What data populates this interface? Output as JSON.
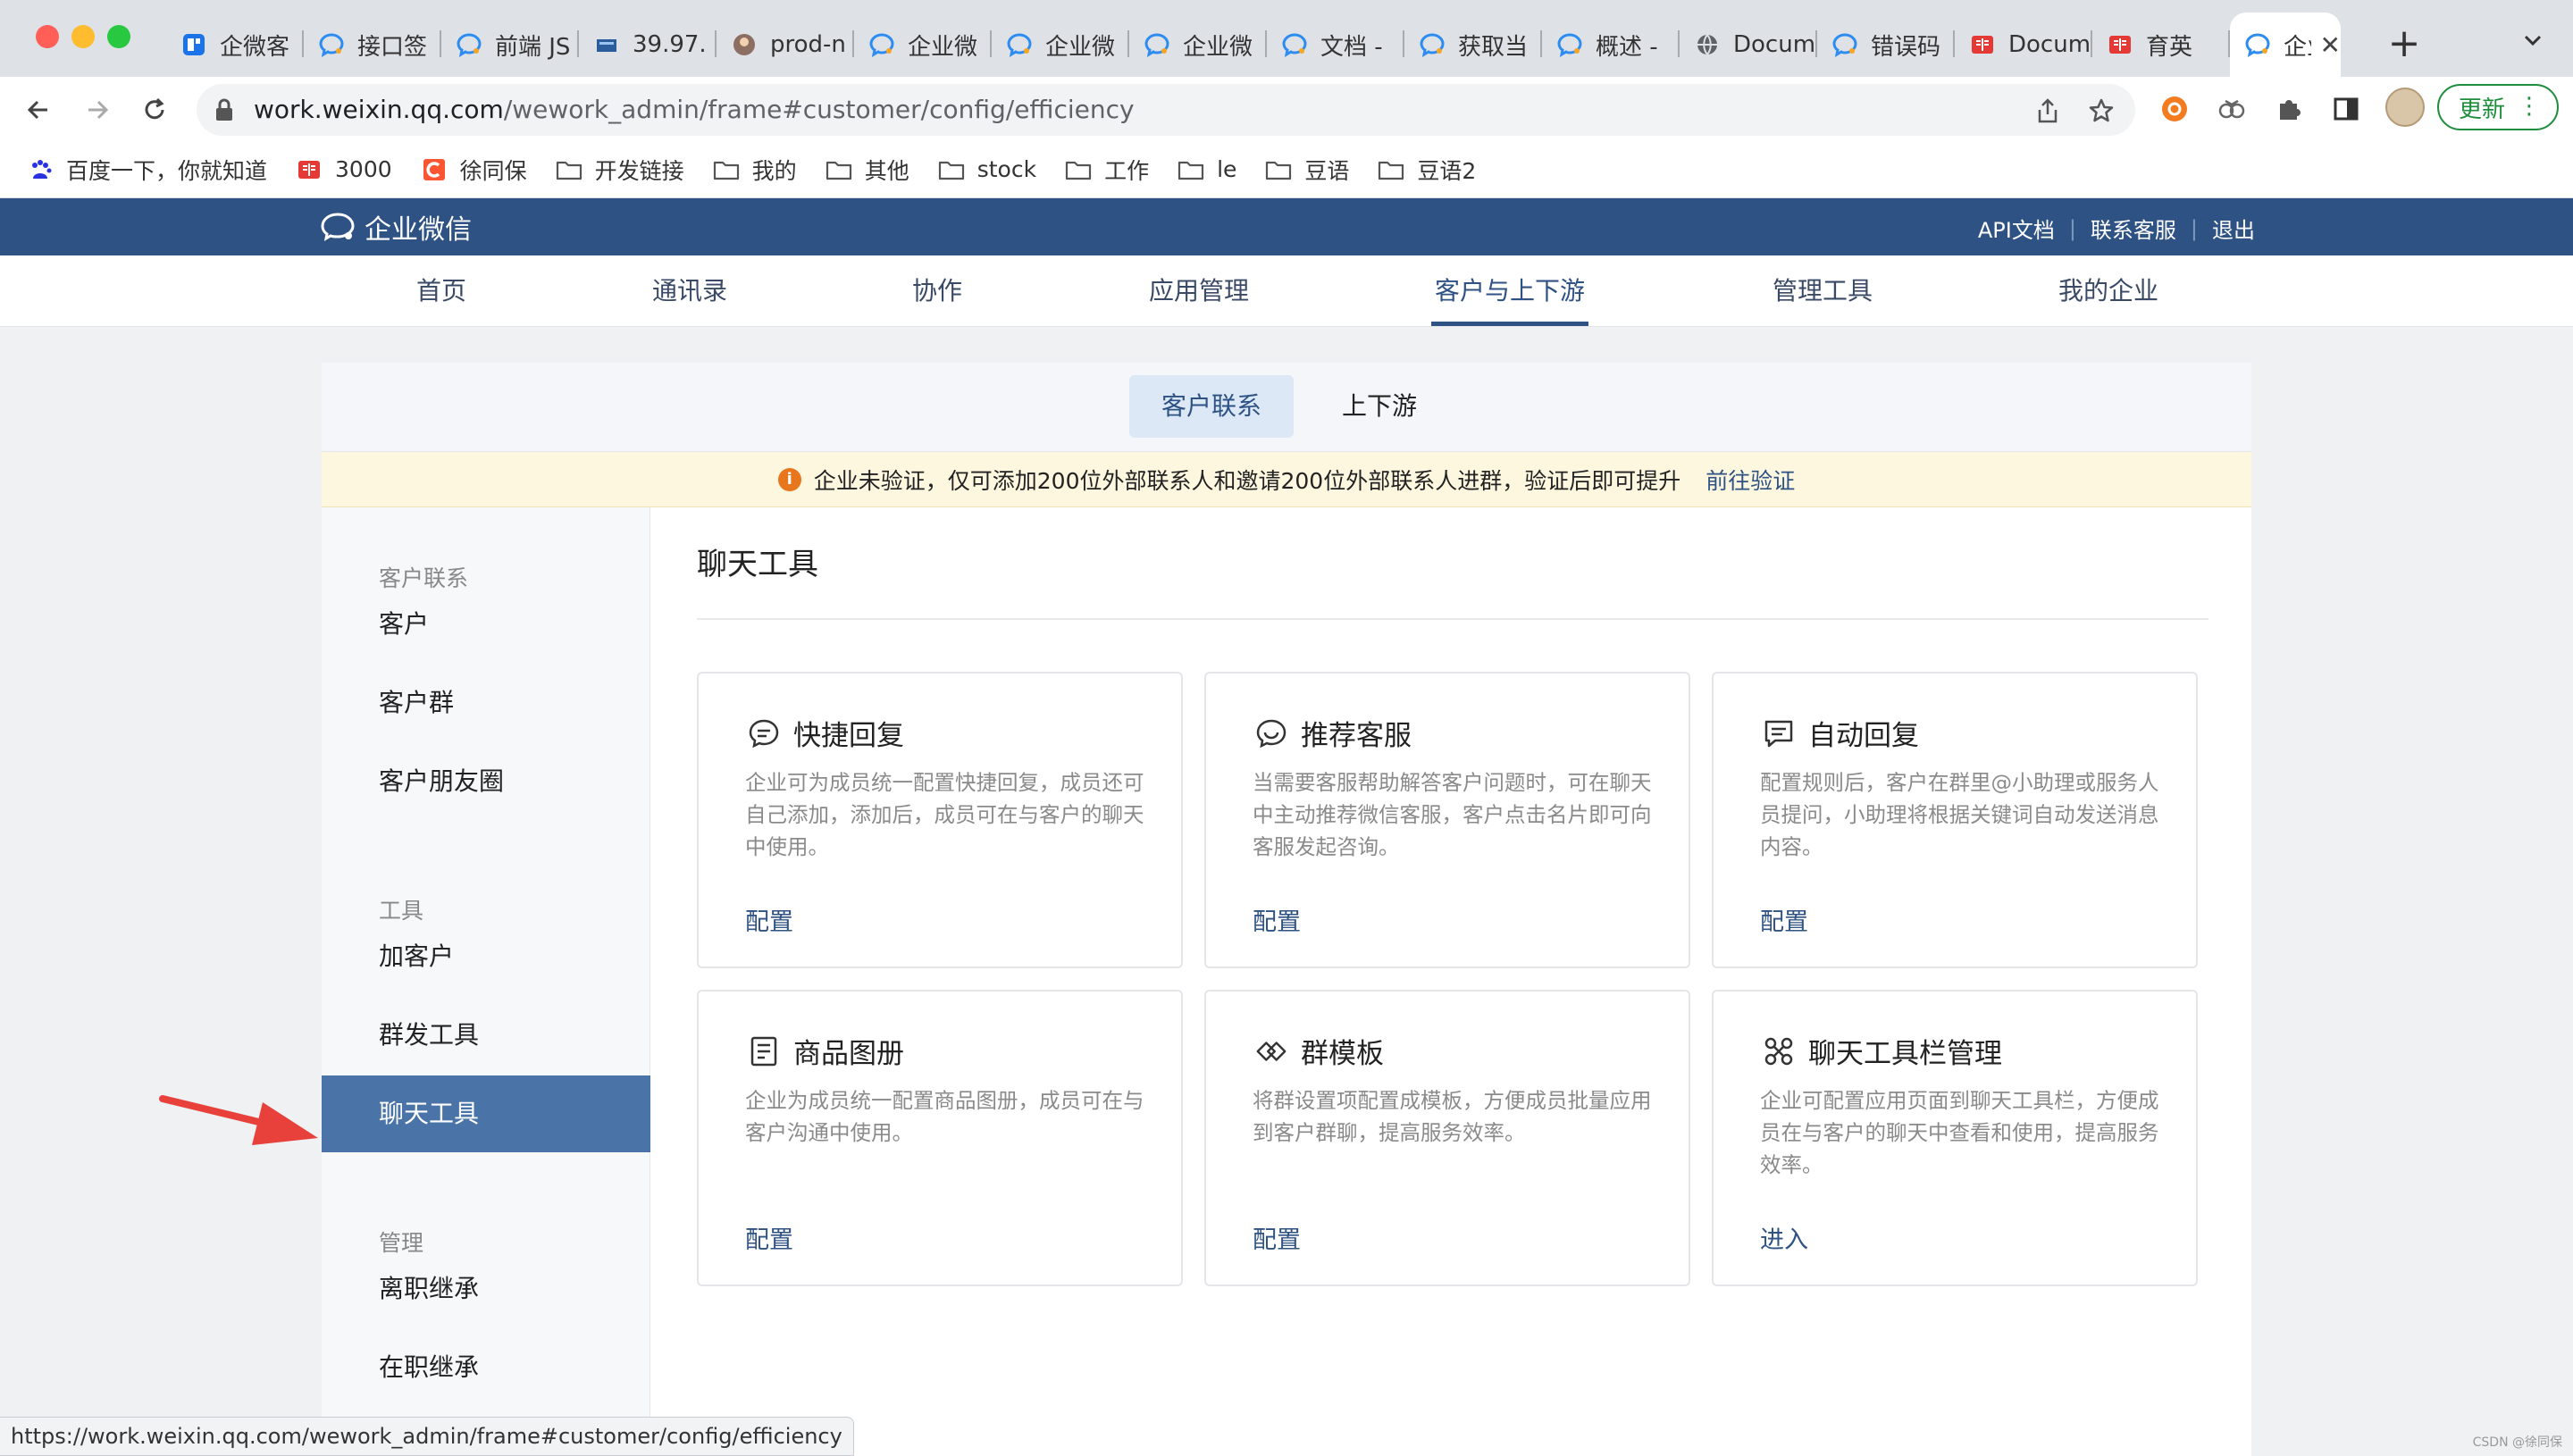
{
  "browser": {
    "tabs": [
      {
        "label": "企微客",
        "icon": "wecom-admin-icon"
      },
      {
        "label": "接口签",
        "icon": "wecom-icon"
      },
      {
        "label": "前端 JS",
        "icon": "wecom-icon"
      },
      {
        "label": "39.97.",
        "icon": "server-icon"
      },
      {
        "label": "prod-n",
        "icon": "avatar-icon"
      },
      {
        "label": "企业微",
        "icon": "wecom-icon"
      },
      {
        "label": "企业微",
        "icon": "wecom-icon"
      },
      {
        "label": "企业微",
        "icon": "wecom-icon"
      },
      {
        "label": "文档 -",
        "icon": "wecom-icon"
      },
      {
        "label": "获取当",
        "icon": "wecom-icon"
      },
      {
        "label": "概述 -",
        "icon": "wecom-icon"
      },
      {
        "label": "Docum",
        "icon": "globe-icon"
      },
      {
        "label": "错误码",
        "icon": "wecom-icon"
      },
      {
        "label": "Docum",
        "icon": "book-icon"
      },
      {
        "label": "育英",
        "icon": "book-icon"
      }
    ],
    "active_tab": {
      "label": "企业",
      "icon": "wecom-icon",
      "close": "✕"
    },
    "new_tab": "+",
    "url_host": "work.weixin.qq.com",
    "url_path": "/wework_admin/frame#customer/config/efficiency",
    "update_label": "更新",
    "update_menu": "⋮",
    "bookmarks": [
      {
        "label": "百度一下，你就知道",
        "icon": "baidu-icon"
      },
      {
        "label": "3000",
        "icon": "book-icon"
      },
      {
        "label": "徐同保",
        "icon": "csdn-icon"
      },
      {
        "label": "开发链接",
        "icon": "folder-icon"
      },
      {
        "label": "我的",
        "icon": "folder-icon"
      },
      {
        "label": "其他",
        "icon": "folder-icon"
      },
      {
        "label": "stock",
        "icon": "folder-icon"
      },
      {
        "label": "工作",
        "icon": "folder-icon"
      },
      {
        "label": "le",
        "icon": "folder-icon"
      },
      {
        "label": "豆语",
        "icon": "folder-icon"
      },
      {
        "label": "豆语2",
        "icon": "folder-icon"
      }
    ],
    "status_url": "https://work.weixin.qq.com/wework_admin/frame#customer/config/efficiency"
  },
  "header": {
    "logo_text": "企业微信",
    "links": [
      "API文档",
      "联系客服",
      "退出"
    ]
  },
  "mainnav": {
    "items": [
      "首页",
      "通讯录",
      "协作",
      "应用管理",
      "客户与上下游",
      "管理工具",
      "我的企业"
    ],
    "active_index": 4
  },
  "subtabs": {
    "active": "客户联系",
    "other": "上下游"
  },
  "notice": {
    "icon": "info-icon",
    "text": "企业未验证，仅可添加200位外部联系人和邀请200位外部联系人进群，验证后即可提升",
    "link": "前往验证"
  },
  "sidebar": {
    "groups": [
      {
        "label": "客户联系",
        "items": [
          "客户",
          "客户群",
          "客户朋友圈"
        ]
      },
      {
        "label": "工具",
        "items": [
          "加客户",
          "群发工具",
          "聊天工具"
        ]
      },
      {
        "label": "管理",
        "items": [
          "离职继承",
          "在职继承"
        ]
      }
    ],
    "active_item": "聊天工具"
  },
  "content": {
    "title": "聊天工具",
    "cards": [
      {
        "icon": "quick-reply-icon",
        "title": "快捷回复",
        "desc": "企业可为成员统一配置快捷回复，成员还可自己添加，添加后，成员可在与客户的聊天中使用。",
        "action": "配置"
      },
      {
        "icon": "recommend-service-icon",
        "title": "推荐客服",
        "desc": "当需要客服帮助解答客户问题时，可在聊天中主动推荐微信客服，客户点击名片即可向客服发起咨询。",
        "action": "配置"
      },
      {
        "icon": "auto-reply-icon",
        "title": "自动回复",
        "desc": "配置规则后，客户在群里@小助理或服务人员提问，小助理将根据关键词自动发送消息内容。",
        "action": "配置"
      },
      {
        "icon": "product-album-icon",
        "title": "商品图册",
        "desc": "企业为成员统一配置商品图册，成员可在与客户沟通中使用。",
        "action": "配置"
      },
      {
        "icon": "group-template-icon",
        "title": "群模板",
        "desc": "将群设置项配置成模板，方便成员批量应用到客户群聊，提高服务效率。",
        "action": "配置"
      },
      {
        "icon": "chat-toolbar-icon",
        "title": "聊天工具栏管理",
        "desc": "企业可配置应用页面到聊天工具栏，方便成员在与客户的聊天中查看和使用，提高服务效率。",
        "action": "进入"
      }
    ]
  },
  "watermark": "CSDN @徐同保",
  "colors": {
    "brand": "#2e5283",
    "sidebar_active": "#4a73a8",
    "notice_bg": "#fdf7e0",
    "arrow": "#e8413c",
    "update_green": "#1e8e3e"
  }
}
